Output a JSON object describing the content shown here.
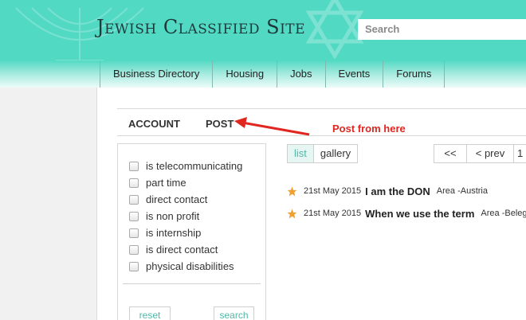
{
  "header": {
    "site_title": "Jewish Classified Site",
    "search_placeholder": "Search",
    "bg_color": "#52d9c4"
  },
  "nav": {
    "items": [
      {
        "label": "Business Directory"
      },
      {
        "label": "Housing"
      },
      {
        "label": "Jobs"
      },
      {
        "label": "Events"
      },
      {
        "label": "Forums"
      }
    ]
  },
  "tabs": {
    "account_label": "ACCOUNT",
    "post_label": "POST"
  },
  "annotation": {
    "text": "Post from here",
    "color": "#e0261f"
  },
  "filters": {
    "items": [
      {
        "label": "is telecommunicating",
        "checked": false
      },
      {
        "label": "part time",
        "checked": false
      },
      {
        "label": "direct contact",
        "checked": false
      },
      {
        "label": "is non profit",
        "checked": false
      },
      {
        "label": "is internship",
        "checked": false
      },
      {
        "label": "is direct contact",
        "checked": false
      },
      {
        "label": "physical disabilities",
        "checked": false
      }
    ],
    "reset_label": "reset",
    "search_label": "search"
  },
  "view_toggle": {
    "list_label": "list",
    "gallery_label": "gallery",
    "active": "list"
  },
  "pager": {
    "first_label": "<<",
    "prev_label": "< prev",
    "page_label": "1"
  },
  "listings": [
    {
      "date": "21st May 2015",
      "title": "I am the DON",
      "area": "Area -Austria",
      "icon": "star-icon"
    },
    {
      "date": "21st May 2015",
      "title": "When we use the term",
      "area": "Area -Beleghata",
      "icon": "star-icon"
    }
  ],
  "colors": {
    "accent": "#52b8a7",
    "star": "#f0a030"
  }
}
